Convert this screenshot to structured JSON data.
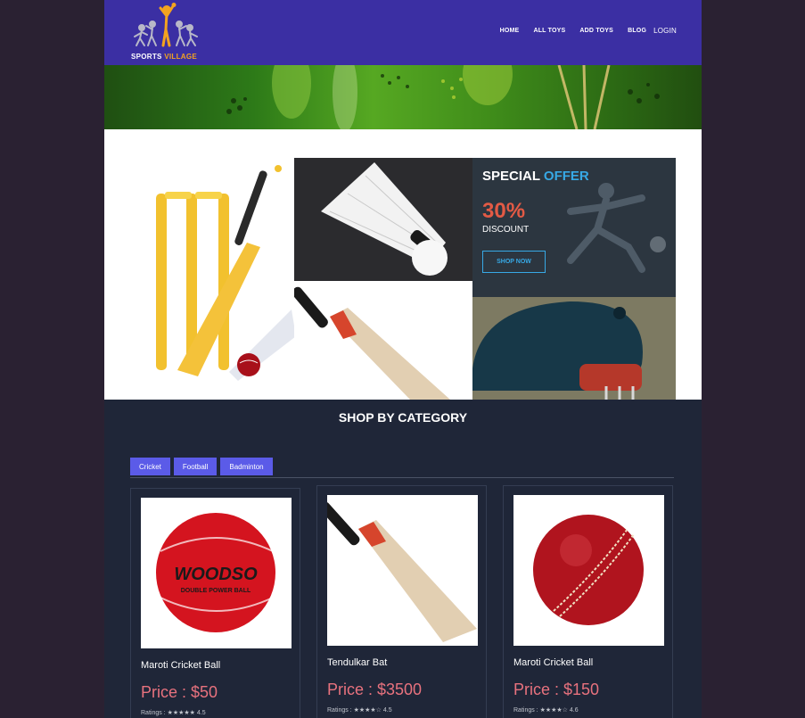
{
  "brand": {
    "name_part1": "SPORTS",
    "name_part2": "VILLAGE"
  },
  "nav": {
    "items": [
      "HOME",
      "ALL TOYS",
      "ADD TOYS",
      "BLOG"
    ],
    "login": "LOGIN"
  },
  "offer": {
    "title_part1": "SPECIAL",
    "title_part2": "OFFER",
    "percent": "30%",
    "label": "DISCOUNT",
    "button": "SHOP NOW"
  },
  "category": {
    "title": "SHOP BY CATEGORY",
    "tabs": [
      "Cricket",
      "Football",
      "Badminton"
    ]
  },
  "products": [
    {
      "name": "Maroti Cricket Ball",
      "price": "Price : $50",
      "rating": "Ratings : ★★★★★ 4.5"
    },
    {
      "name": "Tendulkar Bat",
      "price": "Price : $3500",
      "rating": "Ratings : ★★★★☆ 4.5"
    },
    {
      "name": "Maroti Cricket Ball",
      "price": "Price : $150",
      "rating": "Ratings : ★★★★☆ 4.6"
    }
  ],
  "colors": {
    "navbar": "#3b2fa3",
    "accent": "#37a9e6",
    "offer_red": "#e35a45",
    "tab": "#5b5be8",
    "price": "#e8727e",
    "section_bg": "#1f2638"
  }
}
